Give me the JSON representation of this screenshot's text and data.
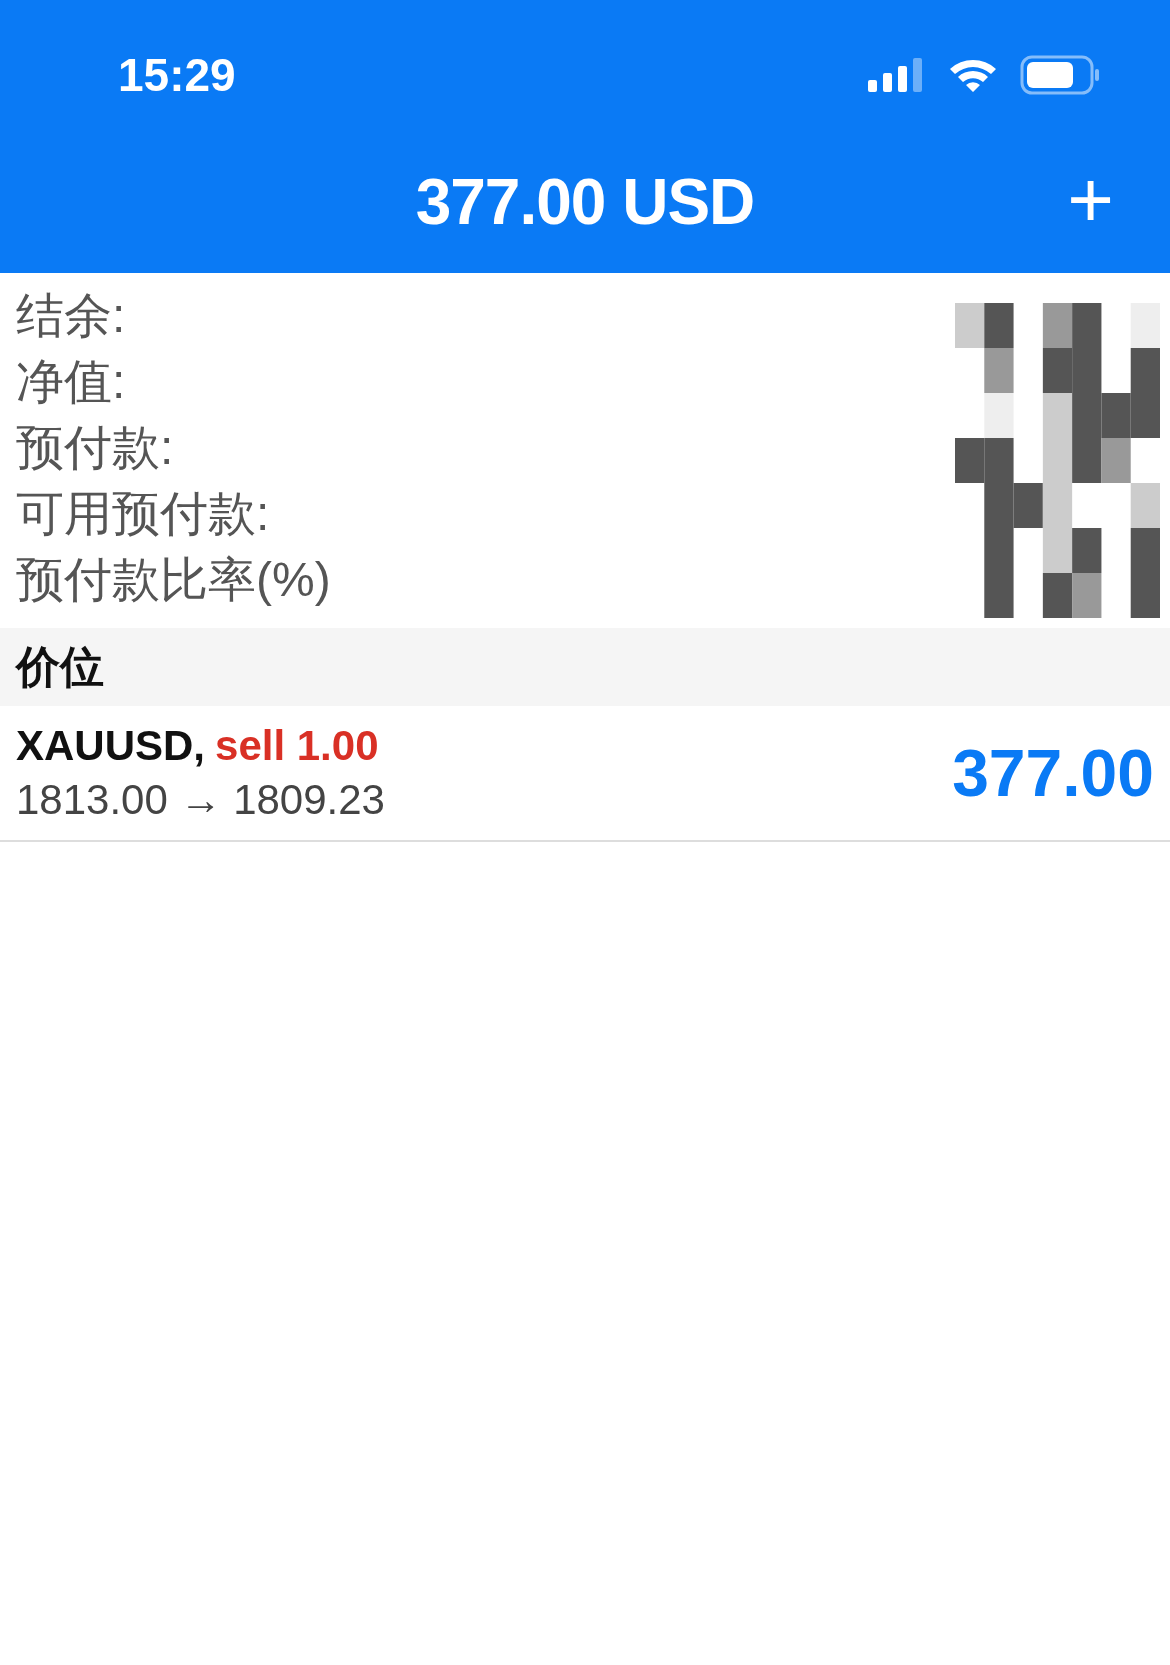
{
  "status_bar": {
    "time": "15:29"
  },
  "header": {
    "title": "377.00 USD",
    "action": "+"
  },
  "summary": [
    {
      "label": "结余:"
    },
    {
      "label": "净值:"
    },
    {
      "label": "预付款:"
    },
    {
      "label": "可用预付款:"
    },
    {
      "label": "预付款比率(%)"
    }
  ],
  "section": {
    "title": "价位"
  },
  "positions": [
    {
      "symbol": "XAUUSD,",
      "order": "sell 1.00",
      "prices": "1813.00 → 1809.23",
      "profit": "377.00"
    }
  ]
}
